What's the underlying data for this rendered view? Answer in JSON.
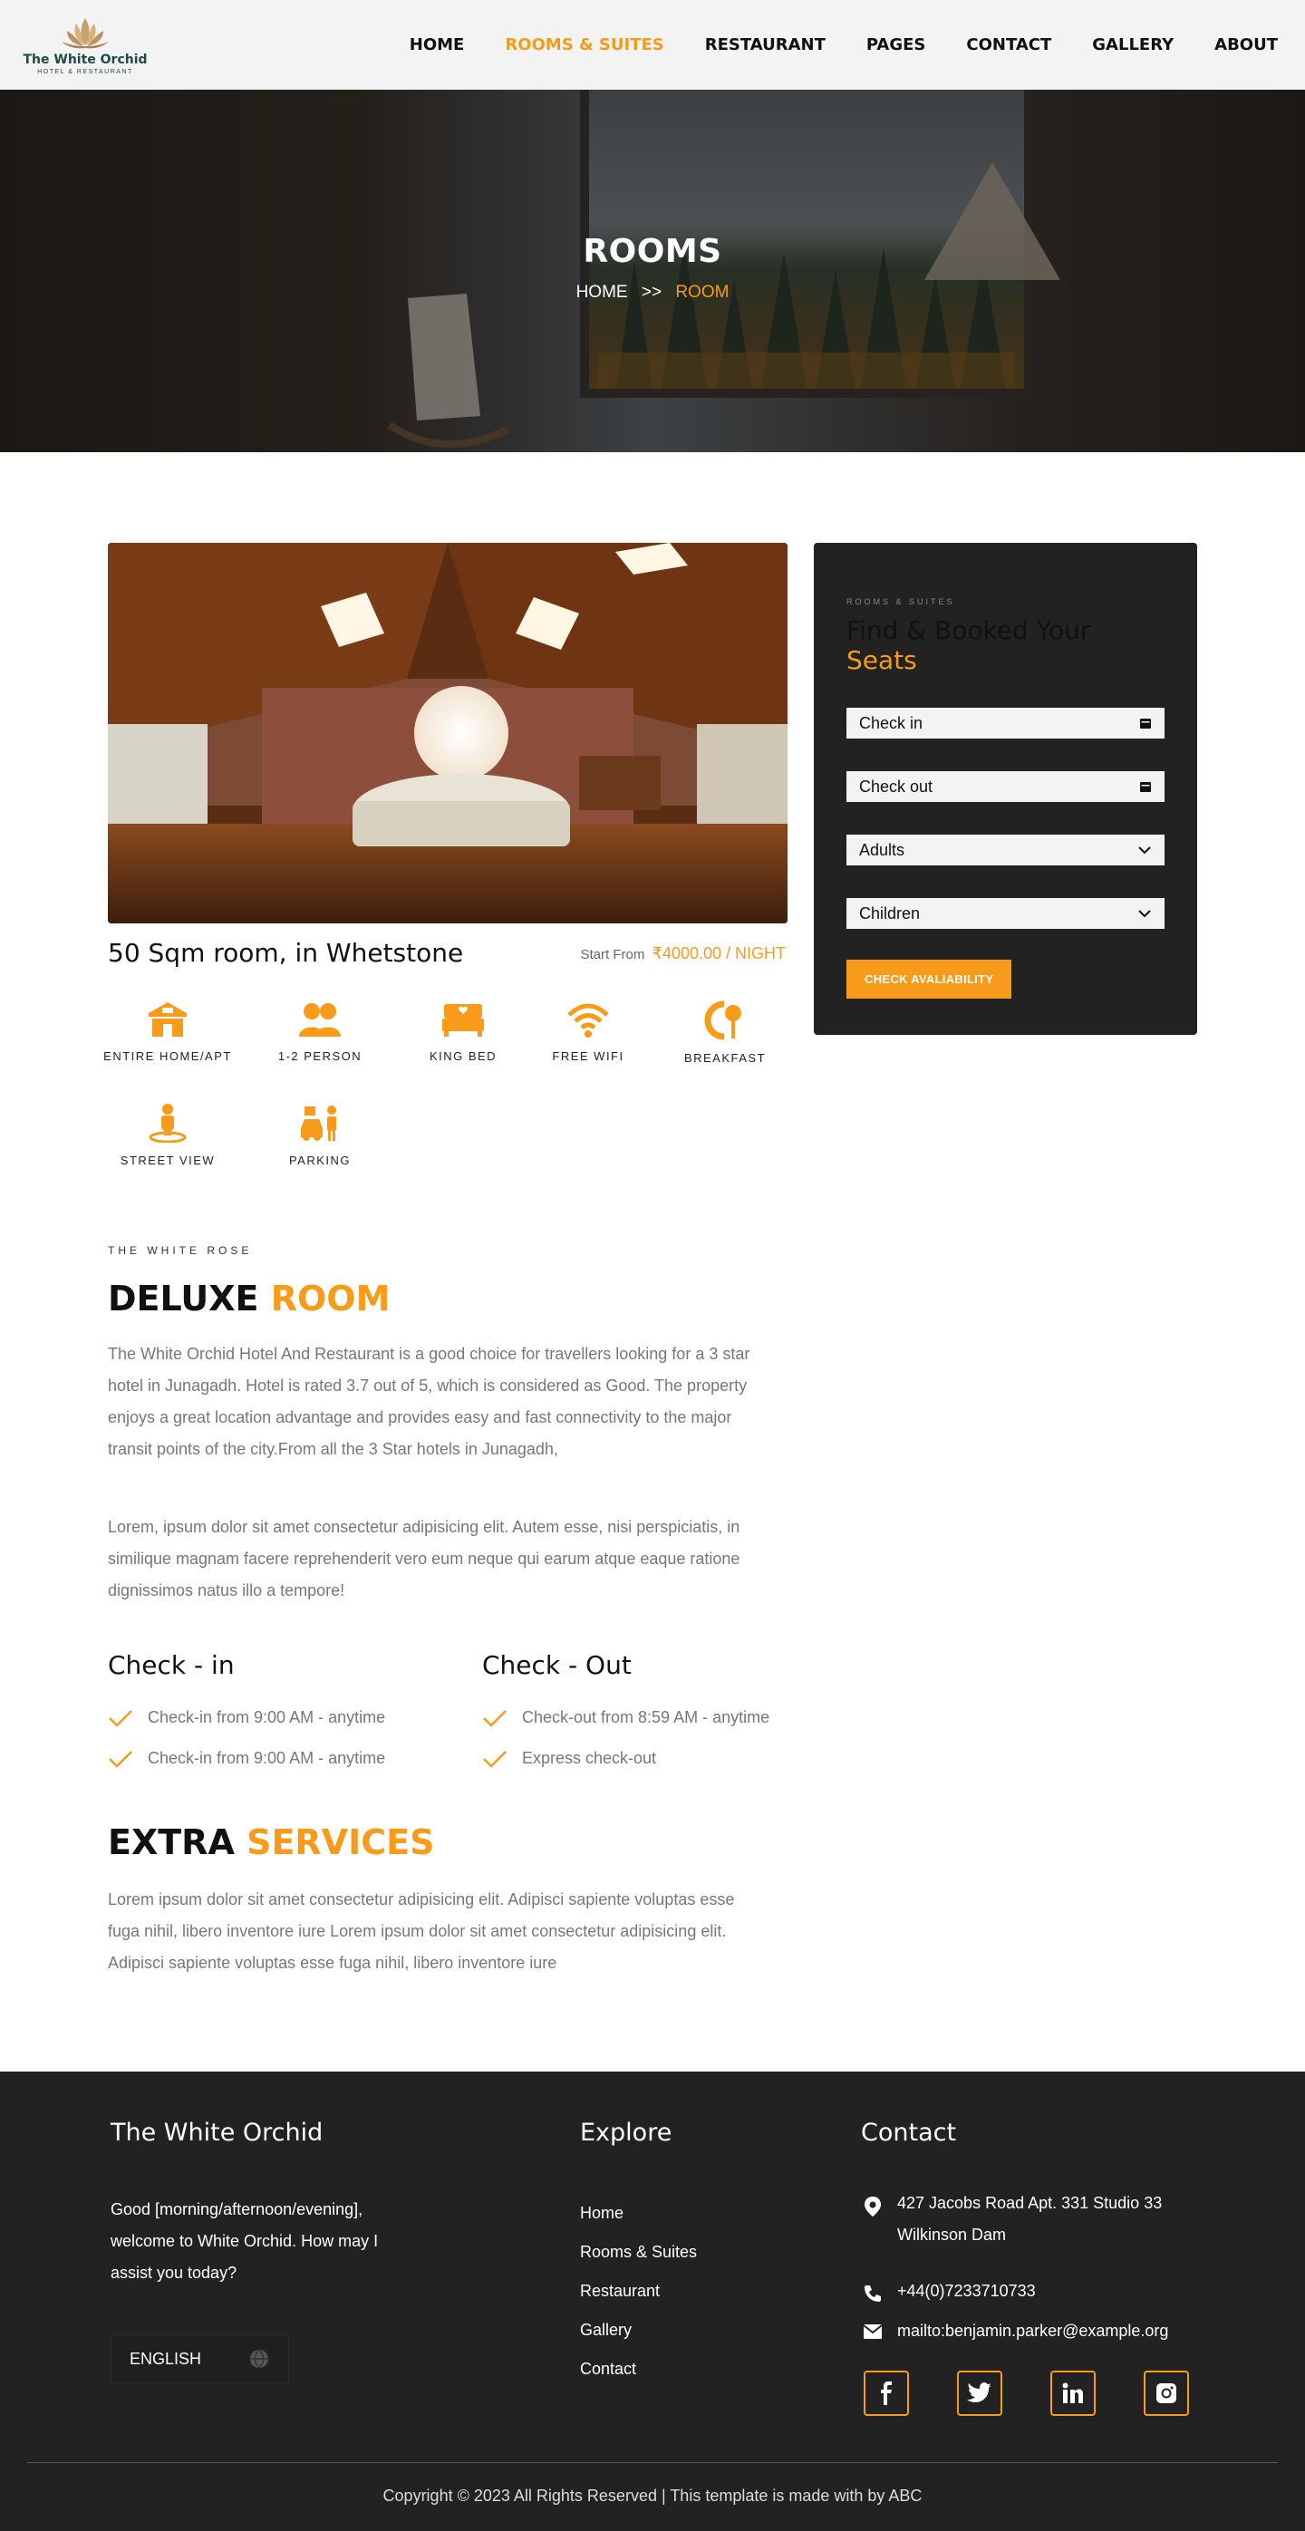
{
  "brand": {
    "name": "The White Orchid",
    "tagline": "HOTEL & RESTAURANT"
  },
  "nav": {
    "items": [
      {
        "label": "HOME",
        "active": false
      },
      {
        "label": "ROOMS & SUITES",
        "active": true
      },
      {
        "label": "RESTAURANT",
        "active": false
      },
      {
        "label": "PAGES",
        "active": false
      },
      {
        "label": "CONTACT",
        "active": false
      },
      {
        "label": "GALLERY",
        "active": false
      },
      {
        "label": "ABOUT",
        "active": false
      }
    ]
  },
  "hero": {
    "title": "ROOMS",
    "breadcrumb": {
      "home": "HOME",
      "separator": ">>",
      "current": "ROOM"
    }
  },
  "room": {
    "title": "50 Sqm room, in Whetstone",
    "price_prefix": "Start From",
    "price": "₹4000.00 / NIGHT"
  },
  "amenities": [
    {
      "icon": "home-icon",
      "label": "ENTIRE HOME/APT"
    },
    {
      "icon": "persons-icon",
      "label": "1-2 PERSON"
    },
    {
      "icon": "bed-icon",
      "label": "KING BED"
    },
    {
      "icon": "wifi-icon",
      "label": "FREE WIFI"
    },
    {
      "icon": "breakfast-icon",
      "label": "BREAKFAST"
    },
    {
      "icon": "street-view-icon",
      "label": "STREET VIEW"
    },
    {
      "icon": "parking-icon",
      "label": "PARKING"
    }
  ],
  "booking": {
    "kicker": "ROOMS & SUITES",
    "title_main": "Find & Booked Your",
    "title_accent": "Seats",
    "check_in": "Check in",
    "check_out": "Check out",
    "adults": "Adults",
    "children": "Children",
    "button": "CHECK AVALIABILITY"
  },
  "about": {
    "kicker": "THE WHITE ROSE",
    "title_main": "DELUXE",
    "title_accent": "ROOM",
    "para1": "The White Orchid Hotel And Restaurant is a good choice for travellers looking for a 3 star hotel in Junagadh. Hotel is rated 3.7 out of 5, which is considered as Good. The property enjoys a great location advantage and provides easy and fast connectivity to the major transit points of the city.From all the 3 Star hotels in Junagadh,",
    "para2": "Lorem, ipsum dolor sit amet consectetur adipisicing elit. Autem esse, nisi perspiciatis, in similique magnam facere reprehenderit vero eum neque qui earum atque eaque ratione dignissimos natus illo a tempore!"
  },
  "checkin": {
    "title": "Check - in",
    "items": [
      "Check-in from 9:00 AM - anytime",
      "Check-in from 9:00 AM - anytime"
    ]
  },
  "checkout": {
    "title": "Check - Out",
    "items": [
      "Check-out from 8:59 AM - anytime",
      "Express check-out"
    ]
  },
  "extra": {
    "title_main": "EXTRA",
    "title_accent": "SERVICES",
    "para": "Lorem ipsum dolor sit amet consectetur adipisicing elit. Adipisci sapiente voluptas esse fuga nihil, libero inventore iure Lorem ipsum dolor sit amet consectetur adipisicing elit. Adipisci sapiente voluptas esse fuga nihil, libero inventore iure"
  },
  "footer": {
    "brand_title": "The White Orchid",
    "greeting": "Good [morning/afternoon/evening], welcome to White Orchid. How may I assist you today?",
    "language": "ENGLISH",
    "explore_title": "Explore",
    "explore_links": [
      "Home",
      "Rooms & Suites",
      "Restaurant",
      "Gallery",
      "Contact"
    ],
    "contact_title": "Contact",
    "address": "427 Jacobs Road Apt. 331 Studio 33 Wilkinson Dam",
    "phone": "+44(0)7233710733",
    "email": "mailto:benjamin.parker@example.org",
    "socials": [
      "facebook-icon",
      "twitter-icon",
      "linkedin-icon",
      "instagram-icon"
    ],
    "copyright": "Copyright © 2023 All Rights Reserved | This template is made with by ABC"
  },
  "colors": {
    "accent": "#f89b1b",
    "dark": "#222222",
    "nav_bg": "#f3f3f3"
  }
}
